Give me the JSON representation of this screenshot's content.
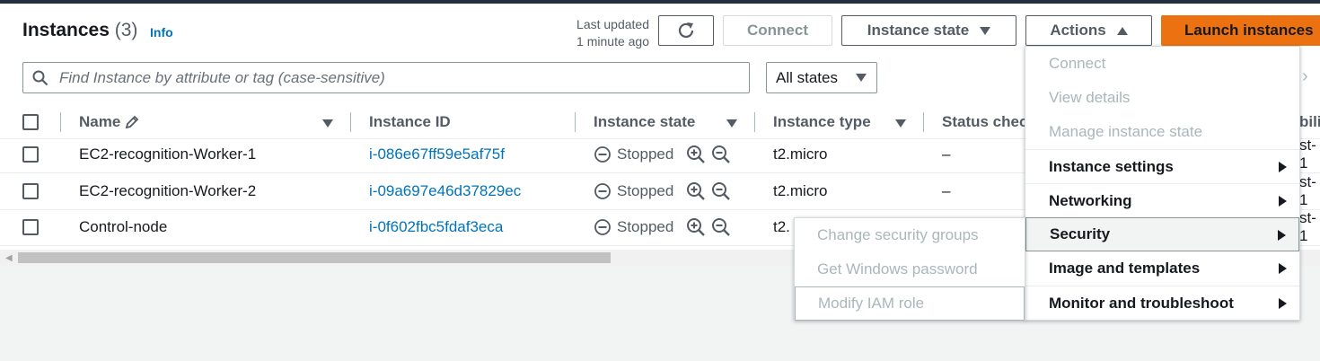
{
  "header": {
    "title": "Instances",
    "count": "(3)",
    "info": "Info",
    "last_updated_line1": "Last updated",
    "last_updated_line2": "1 minute ago"
  },
  "toolbar": {
    "connect": "Connect",
    "instance_state": "Instance state",
    "actions": "Actions",
    "launch": "Launch instances"
  },
  "search": {
    "placeholder": "Find Instance by attribute or tag (case-sensitive)"
  },
  "filter": {
    "selected": "All states"
  },
  "table": {
    "columns": [
      "Name",
      "Instance ID",
      "Instance state",
      "Instance type",
      "Status chec",
      "bili"
    ],
    "rows": [
      {
        "name": "EC2-recognition-Worker-1",
        "id": "i-086e67ff59e5af75f",
        "state": "Stopped",
        "type": "t2.micro",
        "status": "–",
        "extra": "st-1"
      },
      {
        "name": "EC2-recognition-Worker-2",
        "id": "i-09a697e46d37829ec",
        "state": "Stopped",
        "type": "t2.micro",
        "status": "–",
        "extra": "st-1"
      },
      {
        "name": "Control-node",
        "id": "i-0f602fbc5fdaf3eca",
        "state": "Stopped",
        "type": "t2.",
        "status": "",
        "extra": "st-1"
      }
    ]
  },
  "actions_menu": {
    "items": [
      {
        "label": "Connect",
        "enabled": false
      },
      {
        "label": "View details",
        "enabled": false
      },
      {
        "label": "Manage instance state",
        "enabled": false
      },
      {
        "label": "Instance settings",
        "enabled": true
      },
      {
        "label": "Networking",
        "enabled": true
      },
      {
        "label": "Security",
        "enabled": true,
        "active": true
      },
      {
        "label": "Image and templates",
        "enabled": true
      },
      {
        "label": "Monitor and troubleshoot",
        "enabled": true
      }
    ]
  },
  "security_submenu": {
    "items": [
      "Change security groups",
      "Get Windows password",
      "Modify IAM role"
    ]
  },
  "colors": {
    "accent_orange": "#ec7211",
    "link_blue": "#0073bb",
    "header_dark": "#232f3e"
  }
}
